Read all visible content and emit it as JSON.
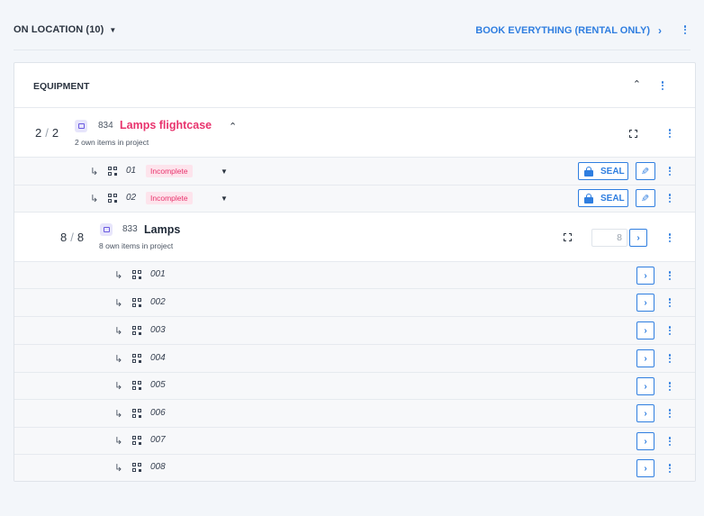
{
  "header": {
    "title": "ON LOCATION (10)",
    "book_label": "BOOK EVERYTHING (RENTAL ONLY)"
  },
  "equipment": {
    "label": "EQUIPMENT"
  },
  "flightcase": {
    "count_current": "2",
    "count_total": "2",
    "code": "834",
    "name": "Lamps flightcase",
    "subtitle": "2 own items in project",
    "subitems": [
      {
        "code": "01",
        "status": "Incomplete",
        "seal_label": "SEAL"
      },
      {
        "code": "02",
        "status": "Incomplete",
        "seal_label": "SEAL"
      }
    ]
  },
  "lamps": {
    "count_current": "8",
    "count_total": "8",
    "code": "833",
    "name": "Lamps",
    "subtitle": "8 own items in project",
    "quantity_value": "8",
    "subitems": [
      {
        "code": "001"
      },
      {
        "code": "002"
      },
      {
        "code": "003"
      },
      {
        "code": "004"
      },
      {
        "code": "005"
      },
      {
        "code": "006"
      },
      {
        "code": "007"
      },
      {
        "code": "008"
      }
    ]
  },
  "colors": {
    "accent": "#2f7ee0",
    "pink": "#e8336d",
    "badge_bg": "#fde4ec",
    "icon_bg": "#e7e5fb",
    "icon_fg": "#6a5ae0"
  },
  "icons": {
    "caret": "caret-down-icon",
    "chevron_right": "chevron-right-icon",
    "kebab": "kebab-icon",
    "arrow": "subitem-arrow-icon",
    "qr": "qr-code-icon",
    "lock": "lock-icon",
    "pencil": "pencil-icon",
    "frame": "fullscreen-icon"
  }
}
